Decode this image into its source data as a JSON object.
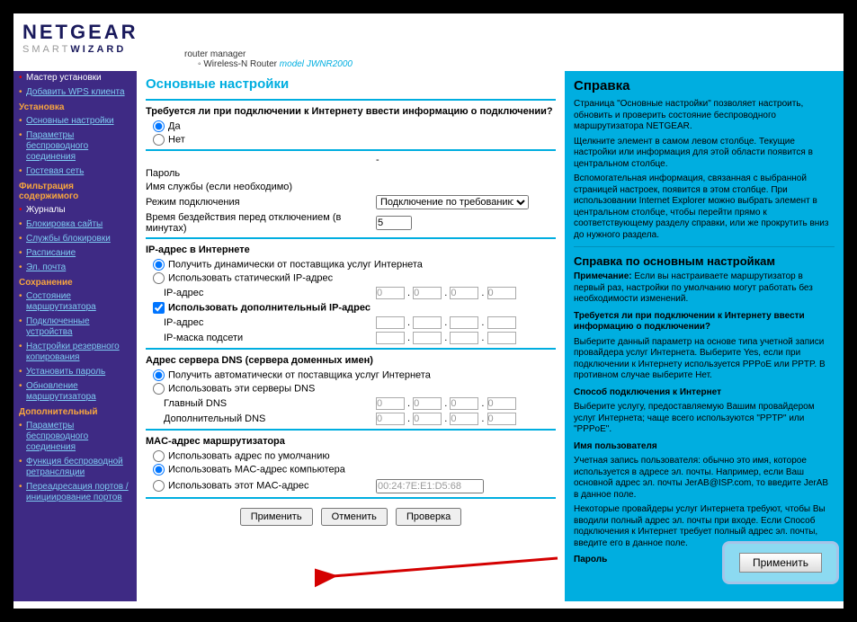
{
  "header": {
    "brand": "NETGEAR",
    "tagline_smart": "SMART",
    "tagline_wizard": "WIZARD",
    "sub1": "router manager",
    "sub2_prefix": "Wireless-N Router ",
    "sub2_model_label": "model",
    "sub2_model": " JWNR2000"
  },
  "sidebar": {
    "groups": [
      {
        "label": null,
        "items": [
          {
            "t": "Мастер установки",
            "active": true
          },
          {
            "t": "Добавить WPS клиента",
            "link": true
          }
        ]
      },
      {
        "label": "Установка",
        "items": [
          {
            "t": "Основные настройки",
            "link": true
          },
          {
            "t": "Параметры беспроводного соединения",
            "link": true
          }
        ]
      },
      {
        "label": null,
        "items": [
          {
            "t": "Гостевая сеть",
            "link": true
          }
        ]
      },
      {
        "label": "Фильтрация содержимого",
        "items": [
          {
            "t": "Журналы",
            "active": true
          },
          {
            "t": "Блокировка сайты",
            "link": true
          },
          {
            "t": "Службы блокировки",
            "link": true
          },
          {
            "t": "Расписание",
            "link": true
          },
          {
            "t": "Эл. почта",
            "link": true
          }
        ]
      },
      {
        "label": "Сохранение",
        "items": [
          {
            "t": "Состояние маршрутизатора",
            "link": true
          },
          {
            "t": "Подключенные устройства",
            "link": true
          },
          {
            "t": "Настройки резервного копирования",
            "link": true
          },
          {
            "t": "Установить пароль",
            "link": true
          },
          {
            "t": "Обновление маршрутизатора",
            "link": true
          }
        ]
      },
      {
        "label": "Дополнительный",
        "items": [
          {
            "t": "Параметры беспроводного соединения",
            "link": true
          },
          {
            "t": "Функция беспроводной ретрансляции",
            "link": true
          },
          {
            "t": "Переадресация портов / инициирование портов",
            "link": true
          }
        ]
      }
    ]
  },
  "main": {
    "title": "Основные настройки",
    "q1": "Требуется ли при подключении к Интернету ввести информацию о подключении?",
    "q1_yes": "Да",
    "q1_no": "Нет",
    "r1": "-",
    "r_password": "Пароль",
    "r_service": "Имя службы (если необходимо)",
    "r_mode": "Режим подключения",
    "r_mode_val": "Подключение по требованию",
    "r_idle": "Время бездействия перед отключением (в минутах)",
    "r_idle_val": "5",
    "sec_ip": "IP-адрес в Интернете",
    "ip_opt1": "Получить динамически от поставщика услуг Интернета",
    "ip_opt2": "Использовать статический IP-адрес",
    "ip_label": "IP-адрес",
    "ip_opt3": "Использовать дополнительный IP-адрес",
    "ip_mask": "IP-маска подсети",
    "ip_oct": "0",
    "sec_dns": "Адрес сервера DNS (сервера доменных имен)",
    "dns_opt1": "Получить автоматически от поставщика услуг Интернета",
    "dns_opt2": "Использовать эти серверы DNS",
    "dns_primary": "Главный DNS",
    "dns_secondary": "Дополнительный DNS",
    "sec_mac": "MAC-адрес маршрутизатора",
    "mac_opt1": "Использовать адрес по умолчанию",
    "mac_opt2": "Использовать MAC-адрес компьютера",
    "mac_opt3": "Использовать этот MAC-адрес",
    "mac_val": "00:24:7E:E1:D5:68",
    "btn_apply": "Применить",
    "btn_cancel": "Отменить",
    "btn_test": "Проверка"
  },
  "help": {
    "title": "Справка",
    "p1": "Страница \"Основные настройки\" позволяет настроить, обновить и проверить состояние беспроводного маршрутизатора NETGEAR.",
    "p2": "Щелкните элемент в самом левом столбце. Текущие настройки или информация для этой области появится в центральном столбце.",
    "p3": "Вспомогательная информация, связанная с выбранной страницей настроек, появится в этом столбце. При использовании Internet Explorer можно выбрать элемент в центральном столбце, чтобы перейти прямо к соответствующему разделу справки, или же прокрутить вниз до нужного раздела.",
    "h3": "Справка по основным настройкам",
    "note_label": "Примечание:",
    "note": " Если вы настраиваете маршрутизатор в первый раз, настройки по умолчанию могут работать без необходимости изменений.",
    "q": "Требуется ли при подключении к Интернету ввести информацию о подключении?",
    "qa": "Выберите данный параметр на основе типа учетной записи провайдера услуг Интернета. Выберите Yes, если при подключении к Интернету используется PPPoE или PPTP. В противном случае выберите Нет.",
    "sub_conn": "Способ подключения к Интернет",
    "conn_p": "Выберите услугу, предоставляемую Вашим провайдером услуг Интернета; чаще всего используются \"PPTP\" или \"PPPoE\".",
    "sub_user": "Имя пользователя",
    "user_p": "Учетная запись пользователя: обычно это имя, которое используется в адресе эл. почты. Например, если Ваш основной адрес эл. почты JerAB@ISP.com, то введите JerAB в данное поле.",
    "user_p2": "Некоторые провайдеры услуг Интернета требуют, чтобы Вы вводили полный адрес эл. почты при входе. Если Способ подключения к Интернет требует полный адрес эл. почты, введите его в данное поле.",
    "sub_pwd": "Пароль"
  },
  "callout": {
    "apply": "Применить"
  }
}
